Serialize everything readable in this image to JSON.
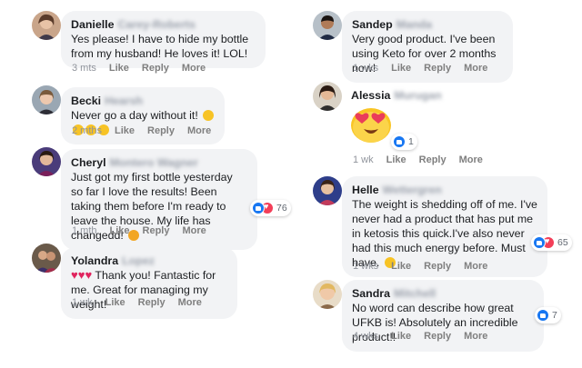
{
  "comments": [
    {
      "first": "Danielle",
      "last": "Carey-Roberts",
      "text": "Yes please! I have to hide my bottle from my husband! He loves it! LOL!",
      "time": "3 mts",
      "like": "Like",
      "reply": "Reply",
      "more": "More"
    },
    {
      "first": "Becki",
      "last": "Hearsh",
      "text": "Never go a day without it!",
      "time": "2 mths",
      "like": "Like",
      "reply": "Reply",
      "more": "More"
    },
    {
      "first": "Cheryl",
      "last": "Montero Wagner",
      "text": "Just got my first bottle yesterday so far I love the results! Been taking them before I'm ready to leave the house. My life has changedd!",
      "time": "1 mth",
      "like": "Like",
      "reply": "Reply",
      "more": "More",
      "reactions": "76"
    },
    {
      "first": "Yolandra",
      "last": "Lopez",
      "text": "Thank you! Fantastic for me. Great for managing my weight!",
      "time": "1 wk",
      "like": "Like",
      "reply": "Reply",
      "more": "More"
    },
    {
      "first": "Sandep",
      "last": "Manda",
      "text": "Very good product. I've been using Keto for over 2 months now!",
      "time": "1 wks",
      "like": "Like",
      "reply": "Reply",
      "more": "More"
    },
    {
      "first": "Alessia",
      "last": "Murugan",
      "time": "1 wk",
      "like": "Like",
      "reply": "Reply",
      "more": "More",
      "reactions": "1"
    },
    {
      "first": "Helle",
      "last": "Wettergren",
      "text": "The weight is shedding off of me. I've never had a product that has put me in ketosis this quick.I've also never had this much energy before. Must have.",
      "time": "1 wks",
      "like": "Like",
      "reply": "Reply",
      "more": "More",
      "reactions": "65"
    },
    {
      "first": "Sandra",
      "last": "Mitchell",
      "text": "No word can describe how great UFKB is! Absolutely an incredible product!!",
      "time": "4 wks",
      "like": "Like",
      "reply": "Reply",
      "more": "More",
      "reactions": "7"
    }
  ],
  "colors": {
    "bubble": "#f2f3f5",
    "like_blue": "#1877f2",
    "love_red": "#f33e58",
    "muted": "#90949c"
  }
}
